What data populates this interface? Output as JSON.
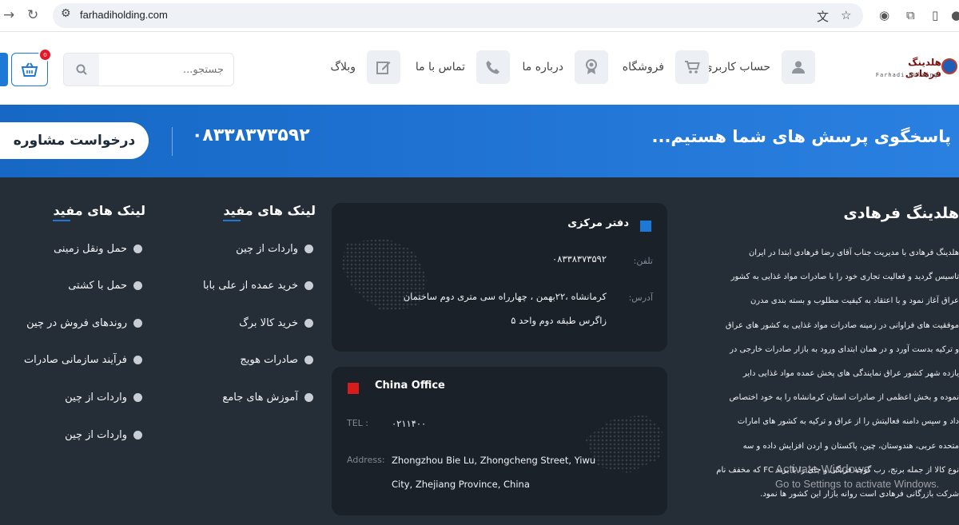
{
  "browser": {
    "url": "farhadiholding.com"
  },
  "header": {
    "logo_name": "هلدینگ فرهادی",
    "logo_sub": "Farhadi Holding",
    "menu": [
      {
        "label": "حساب کاربری من",
        "icon": "user-icon"
      },
      {
        "label": "فروشگاه",
        "icon": "cart-icon"
      },
      {
        "label": "درباره ما",
        "icon": "award-icon"
      },
      {
        "label": "تماس با ما",
        "icon": "phone-icon"
      },
      {
        "label": "وبلاگ",
        "icon": "edit-icon"
      }
    ],
    "search_placeholder": "جستجو...",
    "cart_count": "0"
  },
  "banner": {
    "question": "پاسخگوی پرسش های شما هستیم...",
    "phone": "۰۸۳۳۸۳۷۳۵۹۲",
    "consult_button": "درخواست مشاوره"
  },
  "about": {
    "title": "هلدینگ فرهادی",
    "lines": [
      "هلدینگ فرهادی با مدیریت جناب آقای رضا فرهادی ابتدا در ایران",
      "تاسیس گردید و فعالیت تجاری خود را با صادرات مواد غذایی به کشور",
      "عراق آغاز نمود و با اعتقاد به کیفیت مطلوب و بسته بندی مدرن",
      "موفقیت های فراوانی در زمینه صادرات مواد غذایی به کشور های عراق",
      "و ترکیه بدست آورد و در همان ابتدای ورود به بازار صادرات خارجی در",
      "یازده شهر کشور عراق نمایندگی های پخش عمده مواد غذایی دایر",
      "نموده و بخش اعظمی از صادرات استان کرمانشاه را به خود اختصاص",
      "داد و سپس دامنه فعالیتش را از عراق و ترکیه به کشور های امارات",
      "متحده عربی، هندوستان، چین، پاکستان و اردن افزایش داده و سه",
      "نوع کالا از جمله برنج، رب گوجه فرنگی و چای را با برند FC که مخفف نام",
      "شرکت بازرگانی فرهادی است روانه بازار این کشور ها نمود."
    ]
  },
  "office_main": {
    "title": "دفتر مرکزی",
    "phone_key": "تلفن:",
    "phone_val": "۰۸۳۳۸۳۷۳۵۹۲",
    "address_key": "آدرس:",
    "address_line1": "کرمانشاه ،۲۲بهمن ، چهارراه سی متری دوم ساختمان",
    "address_line2": "زاگرس طبقه دوم واحد ۵"
  },
  "office_china": {
    "title": "China Office",
    "tel_key": "TEL :",
    "tel_val": "۰۲۱۱۴۰۰",
    "address_key": "Address:",
    "address_line1": "Zhongzhou Bie Lu, Zhongcheng Street, Yiwu",
    "address_line2": "City, Zhejiang Province, China"
  },
  "links_col1": {
    "title": "لینک های مفید",
    "items": [
      "واردات از چین",
      "خرید عمده از علی بابا",
      "خرید کالا برگ",
      "صادرات هویج",
      "آموزش های جامع"
    ]
  },
  "links_col2": {
    "title": "لینک های مفید",
    "items": [
      "حمل ونقل زمینی",
      "حمل با کشتی",
      "روندهای فروش در چین",
      "فرآیند سازمانی صادرات",
      "واردات از چین",
      "واردات از چین"
    ]
  },
  "watermark": {
    "line1": "Activate Windows",
    "line2": "Go to Settings to activate Windows."
  },
  "colors": {
    "accent": "#1e78d6",
    "footer_bg": "#252d36",
    "card_bg": "#1b2129",
    "china_red": "#d81b1b"
  }
}
